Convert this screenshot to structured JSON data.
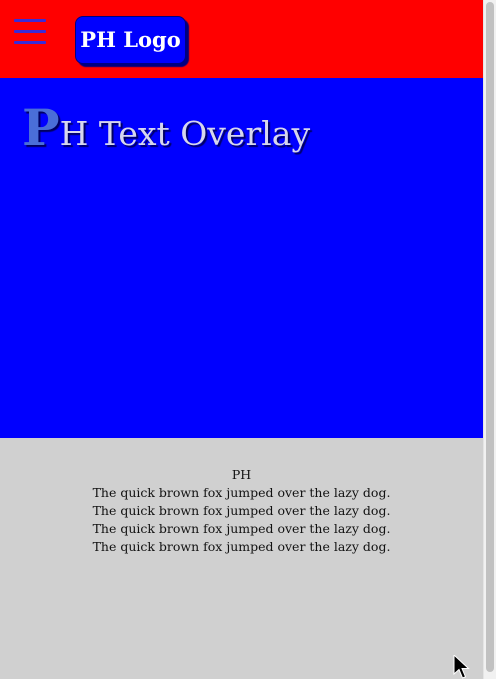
{
  "header": {
    "menu_icon": "hamburger-menu-icon",
    "logo_label": "PH Logo",
    "background": "#ff0000"
  },
  "hero": {
    "title_initial": "P",
    "title_rest": "H Text Overlay",
    "background": "#0000ff"
  },
  "content": {
    "heading": "PH",
    "lines": [
      "The quick brown fox jumped over the lazy dog.",
      "The quick brown fox jumped over the lazy dog.",
      "The quick brown fox jumped over the lazy dog.",
      "The quick brown fox jumped over the lazy dog."
    ]
  }
}
